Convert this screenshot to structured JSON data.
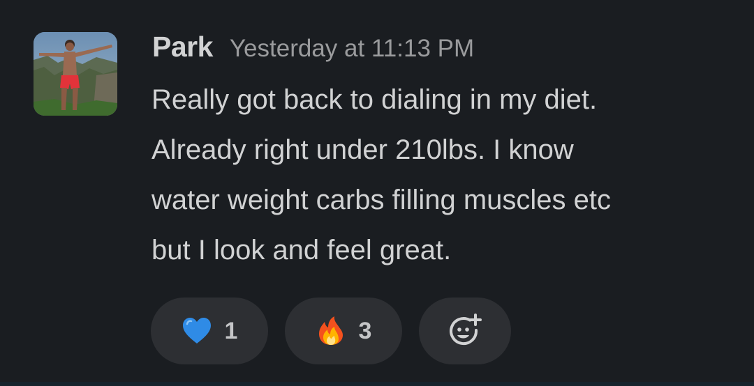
{
  "message": {
    "author": "Park",
    "timestamp": "Yesterday at 11:13 PM",
    "lines": [
      "Really got back to dialing in my diet.",
      "Already right under 210lbs. I know",
      "water weight carbs filling muscles etc",
      "but I look and feel great."
    ]
  },
  "reactions": [
    {
      "emoji": "blue-heart",
      "count": "1"
    },
    {
      "emoji": "fire",
      "count": "3"
    }
  ],
  "add_reaction": {
    "icon": "add-reaction-icon"
  },
  "colors": {
    "background": "#1a1d21",
    "pill": "#2d2f33",
    "text": "#d1d2d3",
    "muted": "#9a9b9d"
  }
}
